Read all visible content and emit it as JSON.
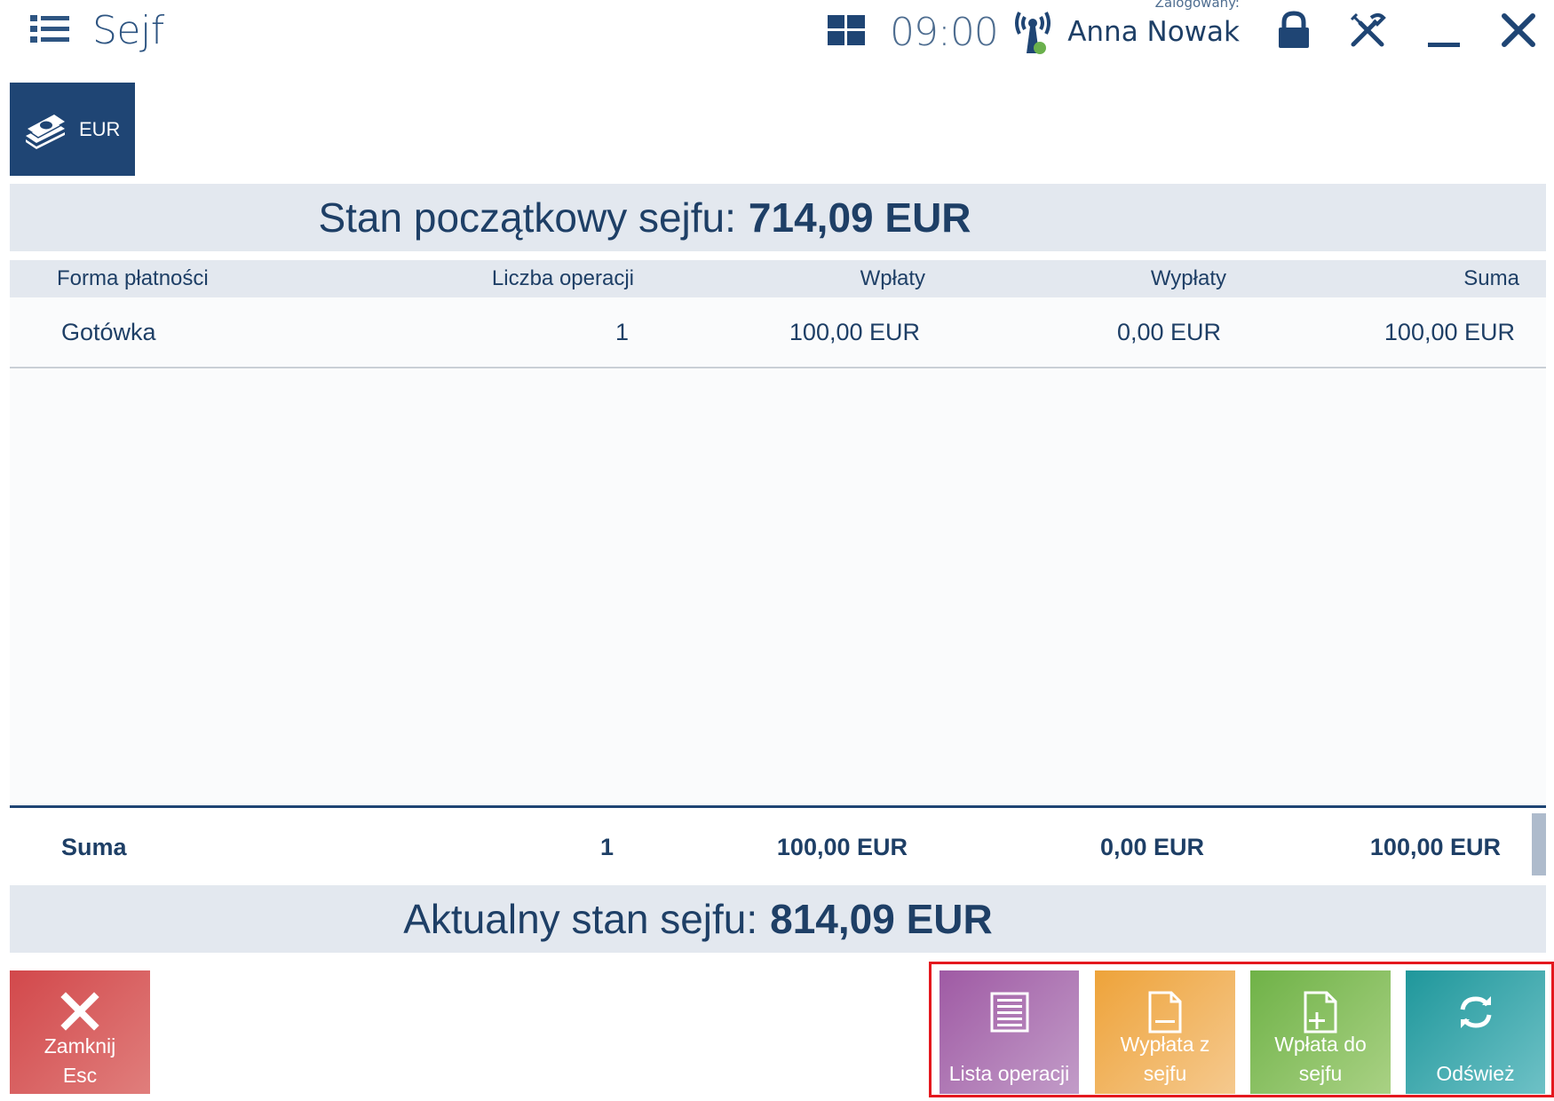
{
  "header": {
    "title": "Sejf",
    "clock": "09:00",
    "logged_label": "Zalogowany:",
    "user_name": "Anna Nowak"
  },
  "currency_tile": {
    "label": "EUR"
  },
  "start_balance": {
    "label": "Stan początkowy sejfu:",
    "value": "714,09 EUR"
  },
  "table": {
    "columns": [
      "Forma płatności",
      "Liczba operacji",
      "Wpłaty",
      "Wypłaty",
      "Suma"
    ],
    "rows": [
      {
        "method": "Gotówka",
        "count": "1",
        "deposits": "100,00 EUR",
        "withdrawals": "0,00 EUR",
        "total": "100,00 EUR"
      }
    ],
    "sum": {
      "label": "Suma",
      "count": "1",
      "deposits": "100,00 EUR",
      "withdrawals": "0,00 EUR",
      "total": "100,00 EUR"
    }
  },
  "current_balance": {
    "label": "Aktualny stan sejfu:",
    "value": "814,09 EUR"
  },
  "buttons": {
    "close": {
      "line1": "Zamknij",
      "line2": "Esc"
    },
    "list": "Lista operacji",
    "payout": {
      "line1": "Wypłata z",
      "line2": "sejfu"
    },
    "deposit": {
      "line1": "Wpłata do",
      "line2": "sejfu"
    },
    "refresh": "Odśwież"
  },
  "colors": {
    "primary": "#1f4574",
    "band": "#e3e8ef",
    "close_button": "#d2484b",
    "list_button": "#9f5aa4",
    "payout_button": "#eea33a",
    "deposit_button": "#6fb247",
    "refresh_button": "#1f979b",
    "highlight_frame": "#e4181e"
  },
  "icons": [
    "menu-icon",
    "windows-icon",
    "signal-icon",
    "lock-icon",
    "tools-icon",
    "minimize-icon",
    "close-icon",
    "cash-icon",
    "list-icon",
    "document-icon",
    "document-add-icon",
    "refresh-icon"
  ]
}
